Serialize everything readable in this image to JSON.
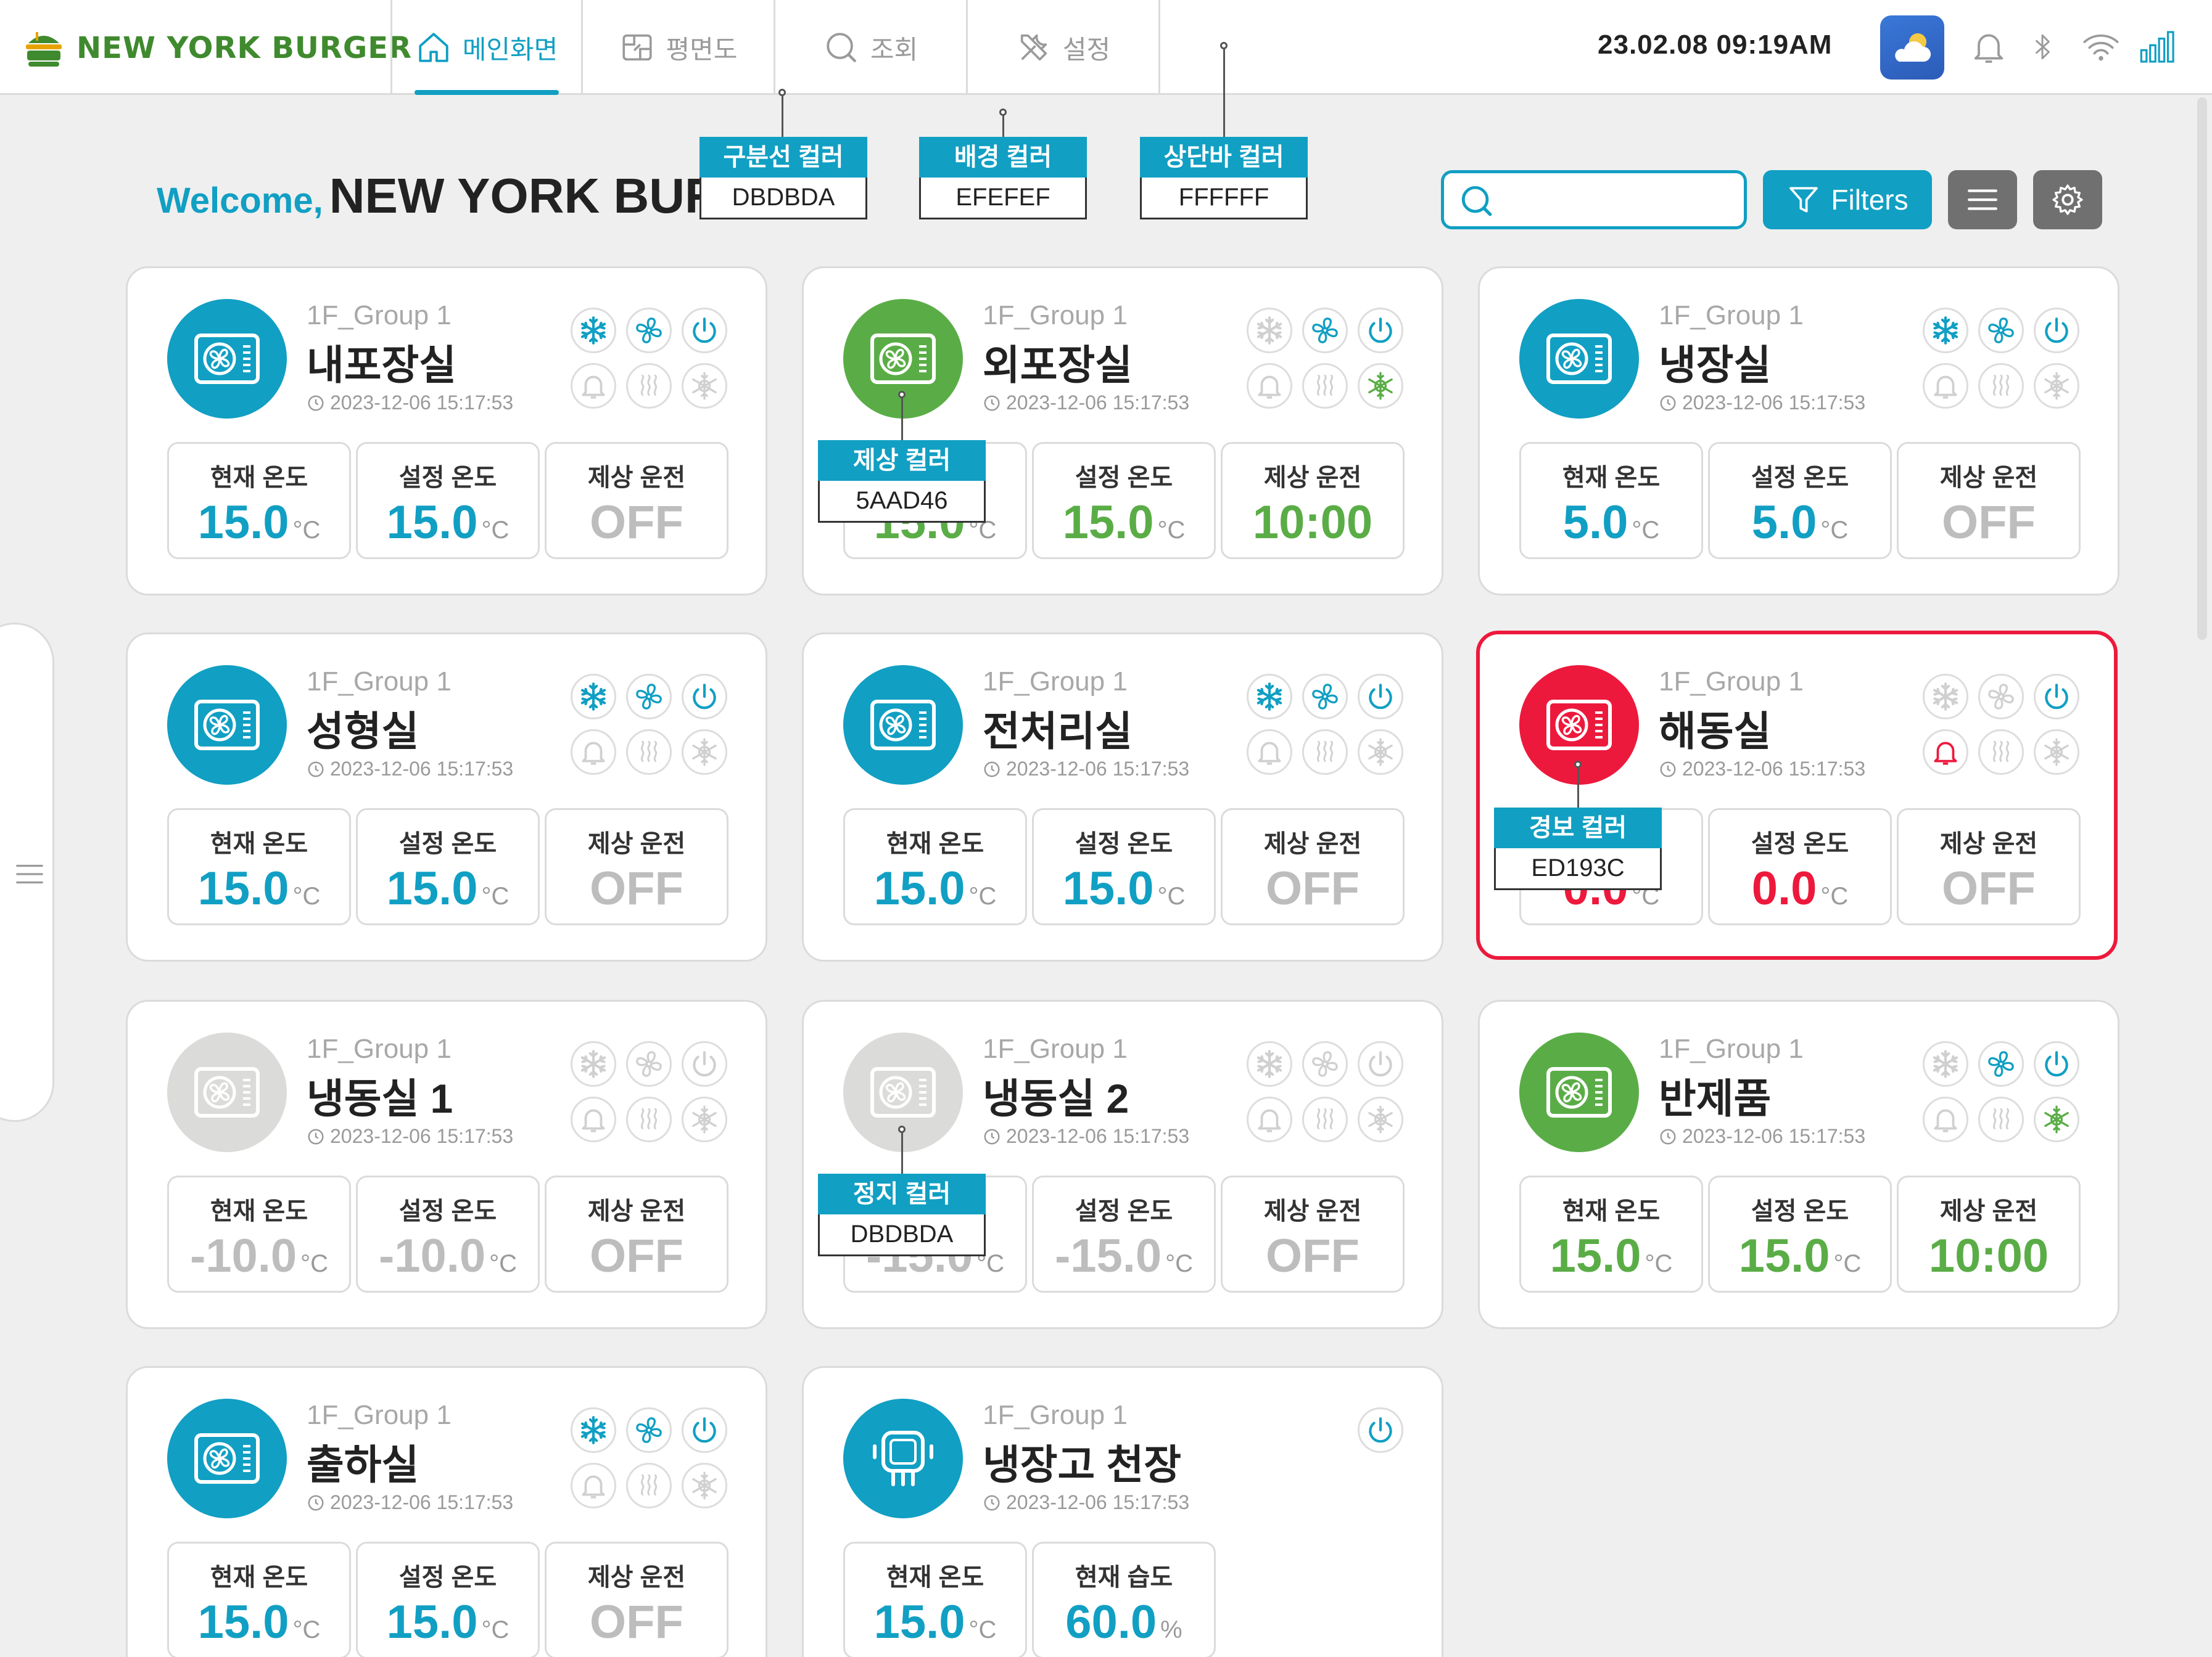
{
  "app": {
    "brand": "NEW YORK BURGER",
    "logo_badge": "New York"
  },
  "nav": [
    {
      "label": "메인화면",
      "icon": "home-icon",
      "active": true
    },
    {
      "label": "평면도",
      "icon": "floorplan-icon",
      "active": false
    },
    {
      "label": "조회",
      "icon": "search-icon",
      "active": false
    },
    {
      "label": "설정",
      "icon": "tools-icon",
      "active": false
    }
  ],
  "status": {
    "datetime": "23.02.08  09:19AM",
    "weather_icon": "cloud-sun-icon"
  },
  "welcome": {
    "greeting": "Welcome,",
    "name": "NEW YORK BURGER"
  },
  "toolbar": {
    "search_placeholder": "",
    "filters_label": "Filters"
  },
  "colors": {
    "primary": "#119FC3",
    "defrost": "#5AAD46",
    "alarm": "#ED193C",
    "stop": "#DBDBDA",
    "divider": "#DBDBDA",
    "background": "#EFEFEF",
    "topbar": "#FFFFFF"
  },
  "annotations": [
    {
      "label": "구분선 컬러",
      "code": "DBDBDA"
    },
    {
      "label": "배경 컬러",
      "code": "EFEFEF"
    },
    {
      "label": "상단바 컬러",
      "code": "FFFFFF"
    },
    {
      "label": "제상 컬러",
      "code": "5AAD46"
    },
    {
      "label": "경보 컬러",
      "code": "ED193C"
    },
    {
      "label": "정지 컬러",
      "code": "DBDBDA"
    }
  ],
  "labels": {
    "current_temp": "현재 온도",
    "set_temp": "설정 온도",
    "defrost_op": "제상 운전",
    "current_humidity": "현재 습도"
  },
  "cards": [
    {
      "group": "1F_Group 1",
      "room": "내포장실",
      "time": "2023-12-06 15:17:53",
      "state": "normal",
      "m1": "15.0",
      "u1": "°C",
      "m2": "15.0",
      "u2": "°C",
      "m3": "OFF"
    },
    {
      "group": "1F_Group 1",
      "room": "외포장실",
      "time": "2023-12-06 15:17:53",
      "state": "defrost",
      "m1": "15.0",
      "u1": "°C",
      "m2": "15.0",
      "u2": "°C",
      "m3": "10:00"
    },
    {
      "group": "1F_Group 1",
      "room": "냉장실",
      "time": "2023-12-06 15:17:53",
      "state": "normal",
      "m1": "5.0",
      "u1": "°C",
      "m2": "5.0",
      "u2": "°C",
      "m3": "OFF"
    },
    {
      "group": "1F_Group 1",
      "room": "성형실",
      "time": "2023-12-06 15:17:53",
      "state": "normal",
      "m1": "15.0",
      "u1": "°C",
      "m2": "15.0",
      "u2": "°C",
      "m3": "OFF"
    },
    {
      "group": "1F_Group 1",
      "room": "전처리실",
      "time": "2023-12-06 15:17:53",
      "state": "normal",
      "m1": "15.0",
      "u1": "°C",
      "m2": "15.0",
      "u2": "°C",
      "m3": "OFF"
    },
    {
      "group": "1F_Group 1",
      "room": "해동실",
      "time": "2023-12-06 15:17:53",
      "state": "alarm",
      "m1": "0.0",
      "u1": "°C",
      "m2": "0.0",
      "u2": "°C",
      "m3": "OFF"
    },
    {
      "group": "1F_Group 1",
      "room": "냉동실 1",
      "time": "2023-12-06 15:17:53",
      "state": "stop",
      "m1": "-10.0",
      "u1": "°C",
      "m2": "-10.0",
      "u2": "°C",
      "m3": "OFF"
    },
    {
      "group": "1F_Group 1",
      "room": "냉동실 2",
      "time": "2023-12-06 15:17:53",
      "state": "stop",
      "m1": "-15.0",
      "u1": "°C",
      "m2": "-15.0",
      "u2": "°C",
      "m3": "OFF"
    },
    {
      "group": "1F_Group 1",
      "room": "반제품",
      "time": "2023-12-06 15:17:53",
      "state": "defrost",
      "m1": "15.0",
      "u1": "°C",
      "m2": "15.0",
      "u2": "°C",
      "m3": "10:00"
    },
    {
      "group": "1F_Group 1",
      "room": "출하실",
      "time": "2023-12-06 15:17:53",
      "state": "normal",
      "m1": "15.0",
      "u1": "°C",
      "m2": "15.0",
      "u2": "°C",
      "m3": "OFF"
    },
    {
      "group": "1F_Group 1",
      "room": "냉장고 천장",
      "time": "2023-12-06 15:17:53",
      "state": "sensor",
      "m1": "15.0",
      "u1": "°C",
      "m2": "60.0",
      "u2": "%"
    }
  ]
}
